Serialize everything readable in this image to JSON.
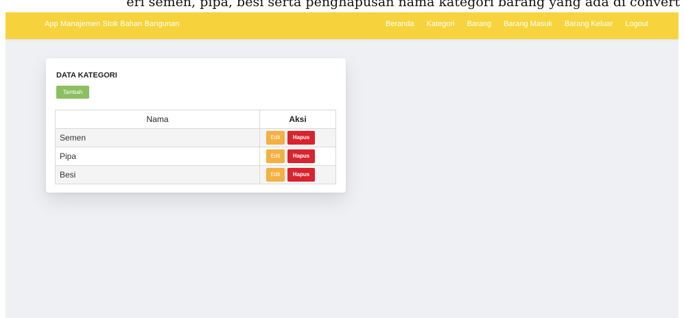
{
  "caption": "eri semen, pipa, besi serta penghapusan nama kategori barang yang ada di convert",
  "navbar": {
    "brand": "App Manajemen Stok Bahan Bangunan",
    "links": [
      "Beranda",
      "Kategori",
      "Barang",
      "Barang Masuk",
      "Barang Keluar",
      "Logout"
    ]
  },
  "card": {
    "title": "DATA KATEGORI",
    "add_label": "Tambah",
    "table": {
      "headers": [
        "Nama",
        "Aksi"
      ],
      "rows": [
        {
          "nama": "Semen",
          "edit": "Edit",
          "hapus": "Hapus"
        },
        {
          "nama": "Pipa",
          "edit": "Edit",
          "hapus": "Hapus"
        },
        {
          "nama": "Besi",
          "edit": "Edit",
          "hapus": "Hapus"
        }
      ]
    }
  },
  "colors": {
    "navbar": "#f6d23c",
    "add_button": "#8cbf62",
    "edit_button": "#f4b042",
    "delete_button": "#d9232e"
  }
}
